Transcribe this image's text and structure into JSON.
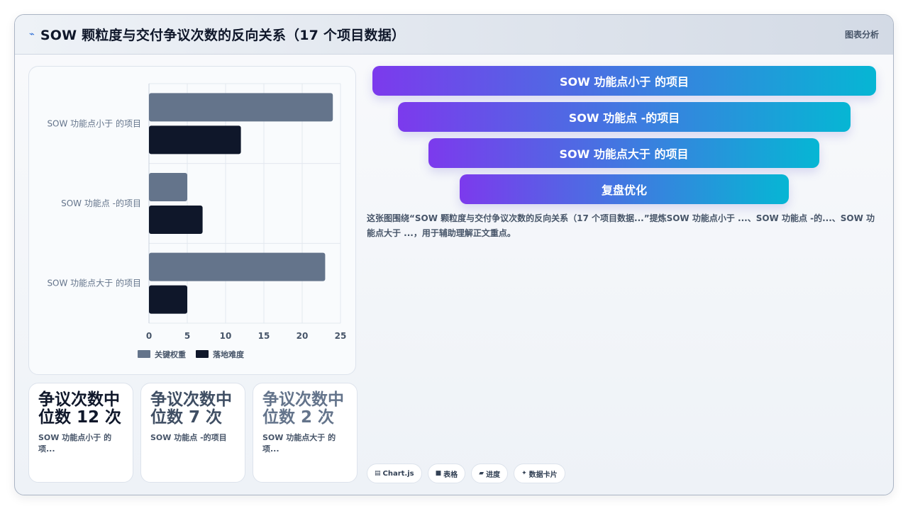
{
  "header": {
    "title": "SOW 颗粒度与交付争议次数的反向关系（17 个项目数据）",
    "tag": "图表分析"
  },
  "chart_data": {
    "type": "bar",
    "orientation": "horizontal",
    "categories": [
      "SOW 功能点小于 的项目",
      "SOW 功能点 -的项目",
      "SOW 功能点大于 的项目"
    ],
    "series": [
      {
        "name": "关键权重",
        "values": [
          24,
          5,
          23
        ],
        "color": "#64748b"
      },
      {
        "name": "落地难度",
        "values": [
          12,
          7,
          5
        ],
        "color": "#0f172a"
      }
    ],
    "xlim": [
      0,
      25
    ],
    "xticks": [
      0,
      5,
      10,
      15,
      20,
      25
    ],
    "grid": true,
    "legend": "bottom"
  },
  "stats": [
    {
      "big": "争议次数中位数 12 次",
      "sub": "SOW 功能点小于 的项...",
      "color": "#0f172a"
    },
    {
      "big": "争议次数中位数 7 次",
      "sub": "SOW 功能点 -的项目",
      "color": "#3f4e63"
    },
    {
      "big": "争议次数中位数 2 次",
      "sub": "SOW 功能点大于 的项...",
      "color": "#64748b"
    }
  ],
  "funnel": [
    {
      "label": "SOW 功能点小于 的项目"
    },
    {
      "label": "SOW 功能点 -的项目"
    },
    {
      "label": "SOW 功能点大于 的项目"
    },
    {
      "label": "复盘优化"
    }
  ],
  "description": "这张图围绕“SOW 颗粒度与交付争议次数的反向关系（17 个项目数据...”提炼SOW 功能点小于 ...、SOW 功能点 -的...、SOW 功能点大于 ...，用于辅助理解正文重点。",
  "chips": [
    {
      "icon": "▤",
      "label": "Chart.js"
    },
    {
      "icon": "■",
      "label": "表格"
    },
    {
      "icon": "▰",
      "label": "进度"
    },
    {
      "icon": "✦",
      "label": "数据卡片"
    }
  ]
}
